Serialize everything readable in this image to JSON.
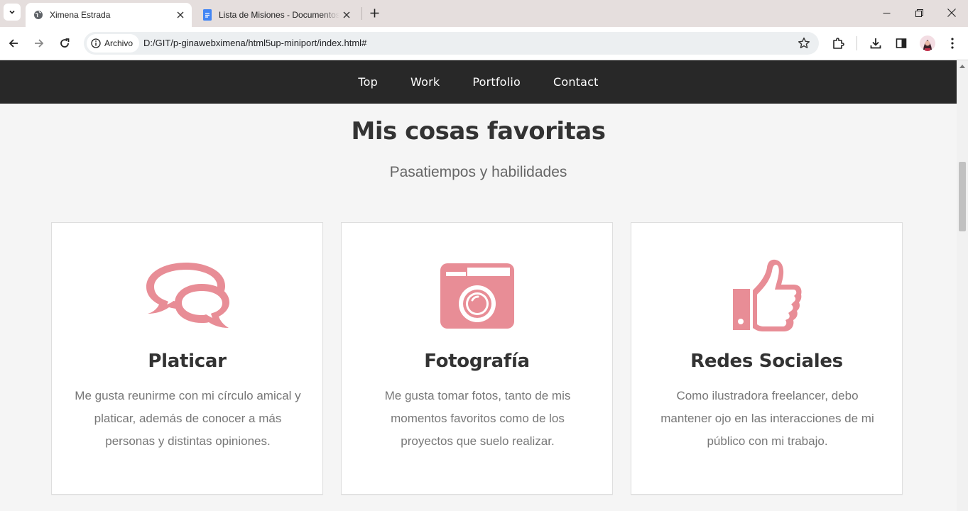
{
  "browser": {
    "tabs": [
      {
        "title": "Ximena Estrada",
        "active": true
      },
      {
        "title": "Lista de Misiones - Documentos",
        "active": false
      }
    ],
    "address": {
      "security_label": "Archivo",
      "url": "D:/GIT/p-ginawebximena/html5up-miniport/index.html#"
    }
  },
  "nav": {
    "items": [
      "Top",
      "Work",
      "Portfolio",
      "Contact"
    ]
  },
  "section": {
    "title": "Mis cosas favoritas",
    "subtitle": "Pasatiempos y habilidades",
    "cards": [
      {
        "icon": "chat-bubbles-icon",
        "title": "Platicar",
        "text": "Me gusta reunirme con mi círculo amical y platicar, además de conocer a más personas y distintas opiniones."
      },
      {
        "icon": "camera-icon",
        "title": "Fotografía",
        "text": "Me gusta tomar fotos, tanto de mis momentos favoritos como de los proyectos que suelo realizar."
      },
      {
        "icon": "thumbs-up-icon",
        "title": "Redes Sociales",
        "text": "Como ilustradora freelancer, debo mantener ojo en las interacciones de mi público con mi trabajo."
      }
    ]
  },
  "colors": {
    "accent": "#e88d96",
    "nav_bg": "#282828",
    "page_bg": "#f5f5f5"
  }
}
